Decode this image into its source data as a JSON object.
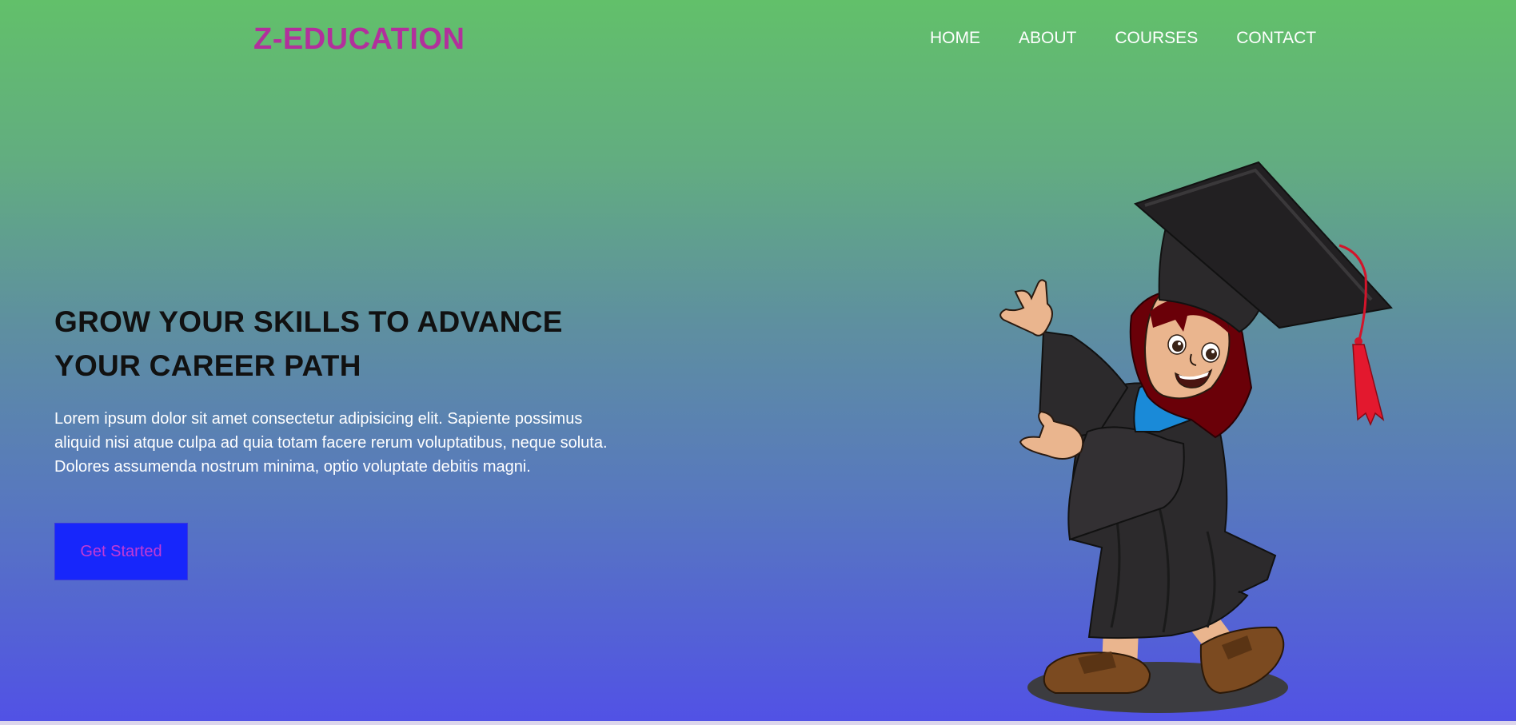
{
  "brand": {
    "name": "Z-EDUCATION"
  },
  "nav": {
    "items": [
      {
        "label": "HOME"
      },
      {
        "label": "ABOUT"
      },
      {
        "label": "COURSES"
      },
      {
        "label": "CONTACT"
      }
    ]
  },
  "hero": {
    "title_line1": "GROW YOUR SKILLS TO ADVANCE",
    "title_line2": "YOUR CAREER PATH",
    "description": "Lorem ipsum dolor sit amet consectetur adipisicing elit. Sapiente possimus aliquid nisi atque culpa ad quia totam facere rerum voluptatibus, neque soluta. Dolores assumenda nostrum minima, optio voluptate debitis magni.",
    "cta_label": "Get Started"
  },
  "colors": {
    "brand": "#b2309c",
    "cta_background": "#1726fb",
    "cta_text": "#c23ad6",
    "gradient_top": "#62c06a",
    "gradient_bottom": "#5151e6"
  },
  "illustration": {
    "icon": "graduate-girl-icon"
  }
}
